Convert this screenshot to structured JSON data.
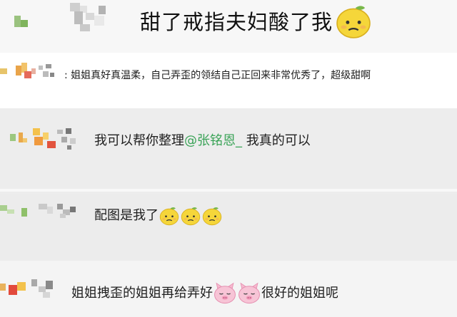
{
  "title": "甜了戒指夫妇酸了我",
  "emoji": {
    "lemon": "lemon-emoji",
    "pig": "pink-pig-emoji"
  },
  "colors": {
    "mention": "#3aa357",
    "lemon_fill": "#f5d63a",
    "pig_fill": "#f7b9cf"
  },
  "comments": [
    {
      "separator": ":",
      "text": "姐姐真好真温柔，自己弄歪的领结自己正回来非常优秀了，超级甜啊"
    },
    {
      "text_before": "我可以帮你整理",
      "mention": "@张铭恩_",
      "text_after": " 我真的可以"
    },
    {
      "text": "配图是我了"
    },
    {
      "text_before": "姐姐拽歪的姐姐再给弄好",
      "text_after": "很好的姐姐呢"
    }
  ]
}
